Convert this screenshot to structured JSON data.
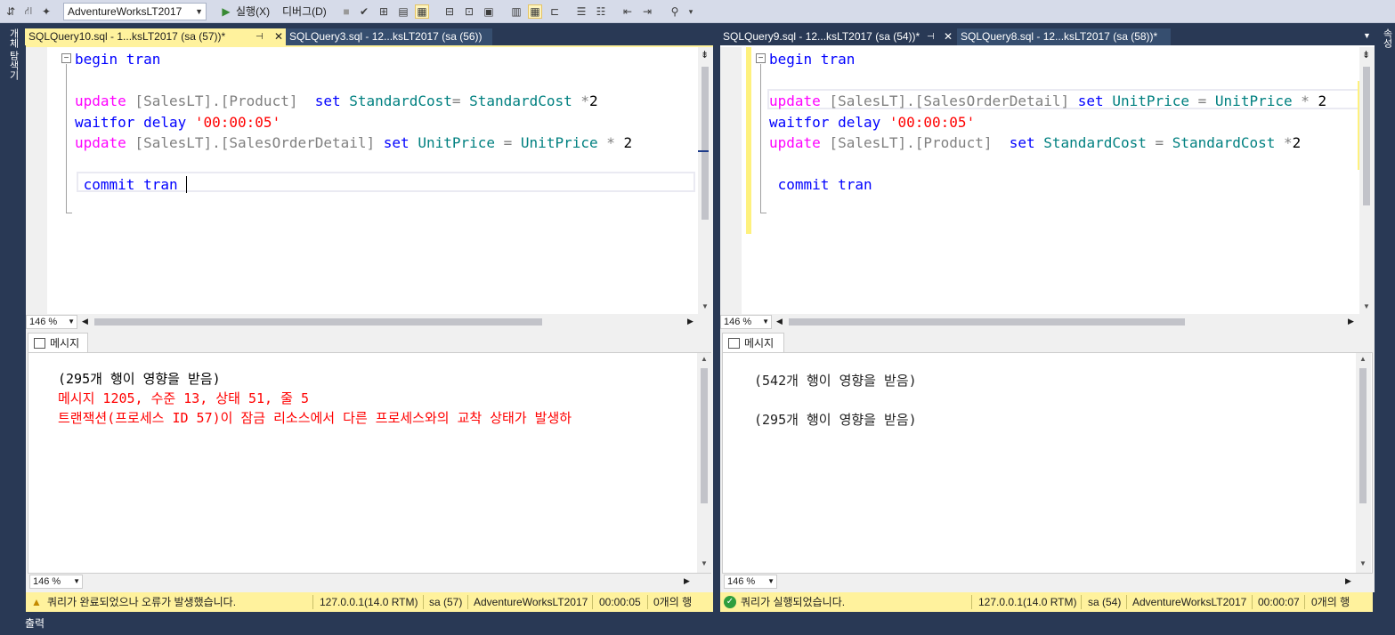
{
  "toolbar": {
    "database": "AdventureWorksLT2017",
    "execute_label": "실행(X)",
    "debug_label": "디버그(D)"
  },
  "sidebar": {
    "left_label": "개체 탐색기",
    "right_label": "속성"
  },
  "left": {
    "tabs": [
      {
        "label": "SQLQuery10.sql - 1...ksLT2017 (sa (57))*"
      },
      {
        "label": "SQLQuery3.sql - 12...ksLT2017 (sa (56))"
      }
    ],
    "code": {
      "l1a": "begin",
      "l1b": " tran",
      "l3a": "update",
      "l3b": " [SalesLT]",
      "l3c": ".",
      "l3d": "[Product]",
      "l3e": "  set",
      "l3f": " StandardCost",
      "l3g": "=",
      "l3h": " StandardCost",
      "l3i": " *",
      "l3j": "2",
      "l4a": "waitfor",
      "l4b": " delay",
      "l4c": " '00:00:05'",
      "l5a": "update",
      "l5b": " [SalesLT]",
      "l5c": ".",
      "l5d": "[SalesOrderDetail]",
      "l5e": " set",
      "l5f": " UnitPrice",
      "l5g": " =",
      "l5h": " UnitPrice",
      "l5i": " *",
      "l5j": " 2",
      "l7a": "commit",
      "l7b": " tran"
    },
    "zoom": "146 %",
    "messages_tab": "메시지",
    "messages": {
      "m1": "(295개 행이 영향을 받음)",
      "m2": "메시지 1205, 수준 13, 상태 51, 줄 5",
      "m3": "트랜잭션(프로세스 ID 57)이 잠금 리소스에서 다른 프로세스와의 교착 상태가 발생하"
    },
    "msg_zoom": "146 %",
    "status": {
      "text": "쿼리가 완료되었으나 오류가 발생했습니다.",
      "server": "127.0.0.1(14.0 RTM)",
      "user": "sa (57)",
      "db": "AdventureWorksLT2017",
      "time": "00:00:05",
      "rows": "0개의 행"
    }
  },
  "right": {
    "tabs": [
      {
        "label": "SQLQuery9.sql - 12...ksLT2017 (sa (54))*"
      },
      {
        "label": "SQLQuery8.sql - 12...ksLT2017 (sa (58))*"
      }
    ],
    "code": {
      "l1a": "begin",
      "l1b": " tran",
      "l3a": "update",
      "l3b": " [SalesLT]",
      "l3c": ".",
      "l3d": "[SalesOrderDetail]",
      "l3e": " set",
      "l3f": " UnitPrice",
      "l3g": " =",
      "l3h": " UnitPrice",
      "l3i": " *",
      "l3j": " 2",
      "l4a": "waitfor",
      "l4b": " delay",
      "l4c": " '00:00:05'",
      "l5a": "update",
      "l5b": " [SalesLT]",
      "l5c": ".",
      "l5d": "[Product]",
      "l5e": "  set",
      "l5f": " StandardCost",
      "l5g": " =",
      "l5h": " StandardCost",
      "l5i": " *",
      "l5j": "2",
      "l7a": "commit",
      "l7b": " tran"
    },
    "zoom": "146 %",
    "messages_tab": "메시지",
    "messages": {
      "m1": "(542개 행이 영향을 받음)",
      "m2": "(295개 행이 영향을 받음)"
    },
    "msg_zoom": "146 %",
    "status": {
      "text": "쿼리가 실행되었습니다.",
      "server": "127.0.0.1(14.0 RTM)",
      "user": "sa (54)",
      "db": "AdventureWorksLT2017",
      "time": "00:00:07",
      "rows": "0개의 행"
    }
  },
  "bottom": {
    "output_label": "출력"
  },
  "colors": {
    "keyword": "#0000ff",
    "magenta": "#ff00ff",
    "string": "#ff0000",
    "status_bg": "#fff29d",
    "chrome": "#293955"
  }
}
